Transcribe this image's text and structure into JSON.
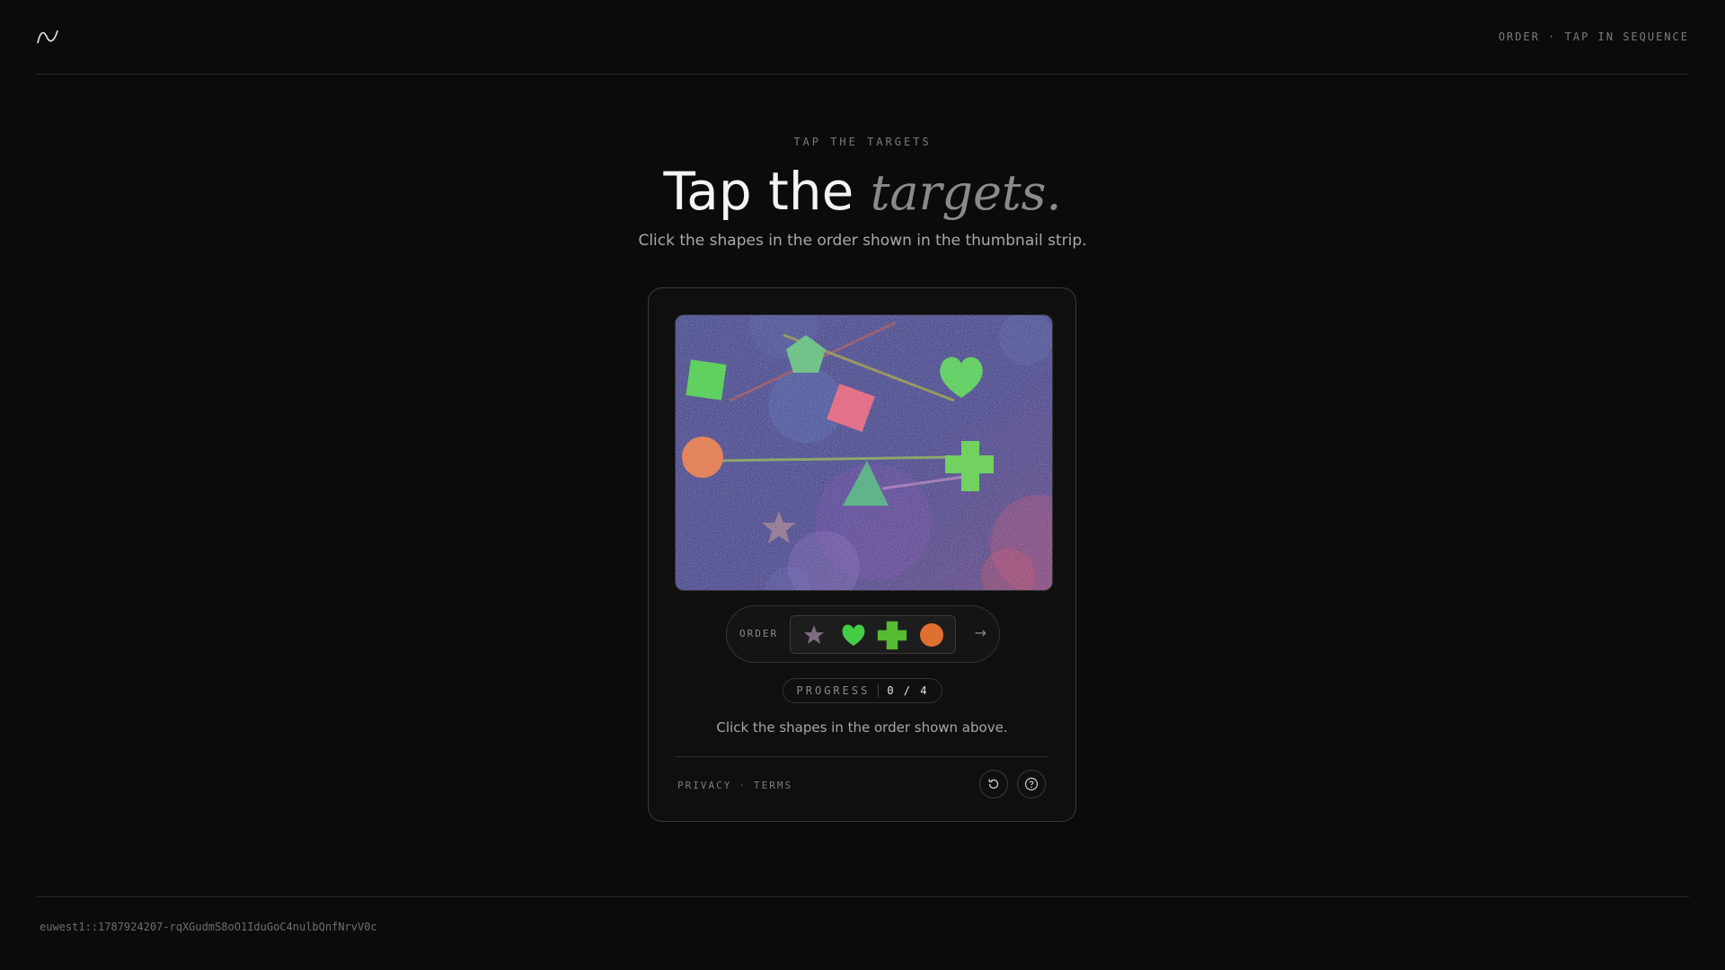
{
  "header": {
    "logo_icon": "wave-logo-icon",
    "mode_label": "ORDER · TAP IN SEQUENCE"
  },
  "hero": {
    "eyebrow": "TAP THE TARGETS",
    "title_main": "Tap the",
    "title_italic": "targets.",
    "subtitle": "Click the shapes in the order shown in the thumbnail strip."
  },
  "challenge": {
    "canvas_shapes": [
      {
        "shape": "square",
        "color": "#33cc33"
      },
      {
        "shape": "pentagon",
        "color": "#55bb77"
      },
      {
        "shape": "heart",
        "color": "#44cc44"
      },
      {
        "shape": "diamond",
        "color": "#e05577"
      },
      {
        "shape": "circle",
        "color": "#e07030"
      },
      {
        "shape": "cross",
        "color": "#55cc33"
      },
      {
        "shape": "triangle",
        "color": "#33aa77"
      },
      {
        "shape": "star",
        "color": "#8a6a8a"
      }
    ],
    "order_label": "ORDER",
    "order_sequence": [
      {
        "shape": "star",
        "icon": "star-icon",
        "color": "#7e6a80"
      },
      {
        "shape": "heart",
        "icon": "heart-icon",
        "color": "#44cc44"
      },
      {
        "shape": "cross",
        "icon": "cross-icon",
        "color": "#55bb33"
      },
      {
        "shape": "circle",
        "icon": "circle-icon",
        "color": "#e07030"
      }
    ],
    "next_icon": "arrow-right-icon",
    "next_arrow": "→",
    "progress_label": "PROGRESS",
    "progress_value": "0 / 4",
    "instruction": "Click the shapes in the order shown above."
  },
  "footer_links": {
    "privacy": "PRIVACY",
    "separator": "·",
    "terms": "TERMS"
  },
  "actions": {
    "refresh_icon": "refresh-icon",
    "help_icon": "help-icon"
  },
  "session": {
    "id": "euwest1::1787924207-rqXGudmS8oO1IduGoC4nulbQnfNrvV0c"
  }
}
